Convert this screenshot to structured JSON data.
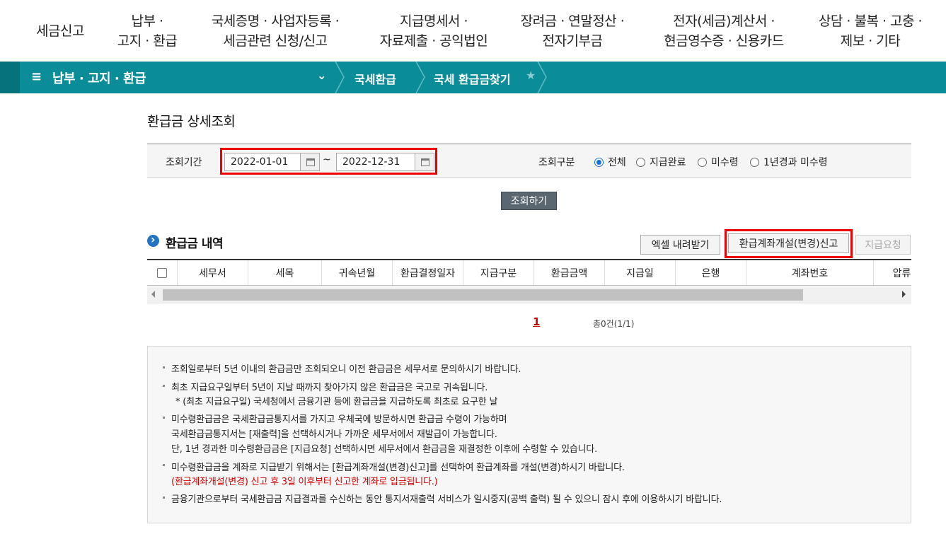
{
  "top_nav": [
    {
      "line1": "세금신고",
      "line2": ""
    },
    {
      "line1": "납부 ·",
      "line2": "고지 · 환급"
    },
    {
      "line1": "국세증명 · 사업자등록 ·",
      "line2": "세금관련 신청/신고"
    },
    {
      "line1": "지급명세서 ·",
      "line2": "자료제출 · 공익법인"
    },
    {
      "line1": "장려금 · 연말정산 ·",
      "line2": "전자기부금"
    },
    {
      "line1": "전자(세금)계산서 ·",
      "line2": "현금영수증 · 신용카드"
    },
    {
      "line1": "상담 · 불복 · 고충 ·",
      "line2": "제보 · 기타"
    }
  ],
  "crumb": {
    "menu_icon": "≡",
    "title": "납부 · 고지 · 환급",
    "chevron": "⌄",
    "level1": "국세환급",
    "level2": "국세 환급금찾기",
    "star": "★"
  },
  "page_title": "환급금 상세조회",
  "search": {
    "period_label": "조회기간",
    "date_from": "2022-01-01",
    "tilde": "~",
    "date_to": "2022-12-31",
    "type_label": "조회구분",
    "options": [
      {
        "label": "전체",
        "selected": true
      },
      {
        "label": "지급완료",
        "selected": false
      },
      {
        "label": "미수령",
        "selected": false
      },
      {
        "label": "1년경과 미수령",
        "selected": false
      }
    ],
    "query_button": "조회하기"
  },
  "section_title": "환급금 내역",
  "buttons": {
    "excel": "엑셀 내려받기",
    "account": "환급계좌개설(변경)신고",
    "request": "지급요청"
  },
  "table": {
    "columns": [
      "세무서",
      "세목",
      "귀속년월",
      "환급결정일자",
      "지급구분",
      "환급금액",
      "지급일",
      "은행",
      "계좌번호",
      "압류"
    ]
  },
  "pager": {
    "current": "1",
    "total": "총0건(1/1)"
  },
  "notices": [
    "조회일로부터 5년 이내의 환급금만 조회되오니 이전 환급금은 세무서로 문의하시기 바랍니다.",
    "최초 지급요구일부터 5년이 지날 때까지 찾아가지 않은 환급금은 국고로 귀속됩니다.",
    "* (최초 지급요구일) 국세청에서 금융기관 등에 환급금을 지급하도록 최초로 요구한 날",
    "미수령환급금은 국세환급금통지서를 가지고 우체국에 방문하시면 환급금 수령이 가능하며",
    "국세환급금통지서는 [재출력]을 선택하시거나 가까운 세무서에서 재발급이 가능합니다.",
    "단, 1년 경과한 미수령환급금은 [지급요청] 선택하시면 세무서에서 환급금을 재결정한 이후에 수령할 수 있습니다.",
    "미수령환급금을 계좌로 지급받기 위해서는 [환급계좌개설(변경)신고]를 선택하여 환급계좌를 개설(변경)하시기 바랍니다.",
    "(환급계좌개설(변경) 신고 후 3일 이후부터 신고한 계좌로 입금됩니다.)",
    "금융기관으로부터 국세환급금 지급결과를 수신하는 동안 통지서재출력 서비스가 일시중지(공백 출력) 될 수 있으니 잠시 후에 이용하시기 바랍니다."
  ],
  "colors": {
    "crumb_bar": "#0a8d99",
    "highlight": "#ee0000",
    "notice_red": "#d40000",
    "query_btn": "#5a6770"
  }
}
